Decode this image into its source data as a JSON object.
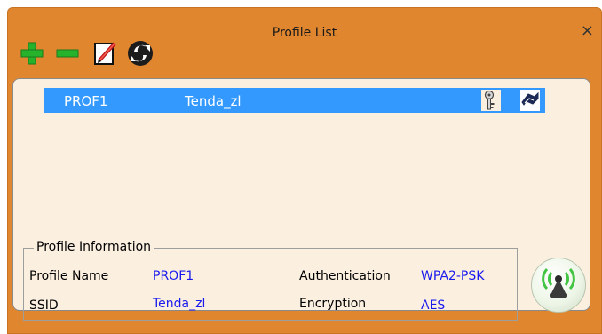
{
  "window": {
    "title": "Profile List",
    "close_label": "×"
  },
  "toolbar": {
    "add_icon": "plus-icon",
    "remove_icon": "minus-icon",
    "edit_icon": "edit-icon",
    "activate_icon": "connect-icon"
  },
  "profiles": [
    {
      "name": "PROF1",
      "ssid": "Tenda_zl",
      "security_icon": "key-icon",
      "status_icon": "connected-icon"
    }
  ],
  "profile_info": {
    "legend": "Profile Information",
    "profile_name_label": "Profile Name",
    "profile_name": "PROF1",
    "ssid_label": "SSID",
    "ssid": "Tenda_zl",
    "authentication_label": "Authentication",
    "authentication": "WPA2-PSK",
    "encryption_label": "Encryption",
    "encryption": "AES"
  },
  "colors": {
    "window_bg": "#e0862f",
    "panel_bg": "#fbefe0",
    "selection": "#3399ff",
    "value_text": "#1a1aee"
  }
}
